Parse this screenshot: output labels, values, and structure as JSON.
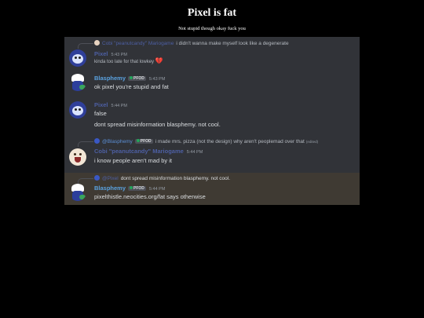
{
  "page": {
    "title": "Pixel is fat",
    "subtitle": "Not stupid though okay fuck you"
  },
  "colors": {
    "pixel_name": "#4d5fa3",
    "blasphemy_name": "#5aa2e0",
    "peanut_name": "#4d5fa3",
    "chat_bg": "#313338",
    "highlight_bg": "#3f3a33"
  },
  "messages": [
    {
      "reply_to_name": "Cobi \"peanutcandy\" Mariogame",
      "reply_to_text": "i didn't wanna make myself look like a degenerate",
      "author": "Pixel",
      "time": "5:43 PM",
      "lines": [
        "kinda too late for that lowkey"
      ],
      "icon": "broken-heart-icon"
    },
    {
      "author": "Blasphemy",
      "badge": "PFOD",
      "time": "5:43 PM",
      "lines": [
        "ok pixel you're stupid and fat"
      ]
    },
    {
      "author": "Pixel",
      "time": "5:44 PM",
      "lines": [
        "false",
        "dont spread misinformation blasphemy. not cool."
      ]
    },
    {
      "reply_to_name": "@Blasphemy",
      "reply_to_badge": "PFOD",
      "reply_to_text": "i made mrs. pizza (not the design) why aren't peoplemad over  that",
      "reply_to_edited": "(edited)",
      "author": "Cobi \"peanutcandy\" Mariogame",
      "time": "5:44 PM",
      "lines": [
        "i know people aren't mad by it"
      ]
    },
    {
      "reply_to_name": "@Pixel",
      "reply_to_text": "dont spread misinformation blasphemy. not cool.",
      "author": "Blasphemy",
      "badge": "PFOD",
      "time": "5:44 PM",
      "lines": [
        "pixelthistle.neocities.org/fat says otherwise"
      ]
    }
  ]
}
